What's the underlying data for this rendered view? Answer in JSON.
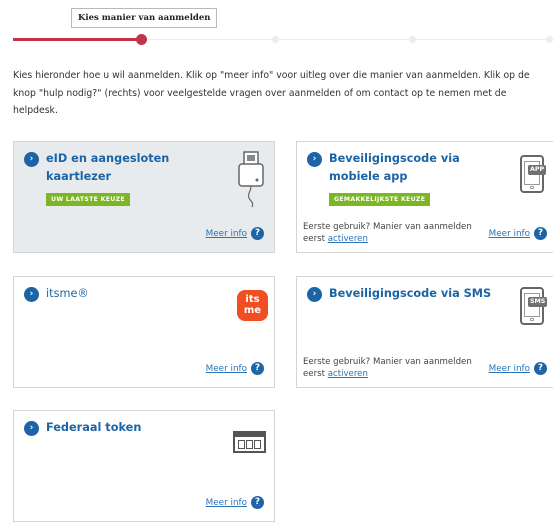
{
  "stepper": {
    "tooltip": "Kies manier van aanmelden",
    "accent_color": "#c2334d"
  },
  "intro": "Kies hieronder hoe u wil aanmelden. Klik op \"meer info\" voor uitleg over die manier van aanmelden. Klik op de knop \"hulp nodig?\" (rechts) voor veelgestelde vragen over aanmelden of om contact op te nemen met de helpdesk.",
  "common": {
    "meer_info": "Meer info",
    "help_glyph": "?",
    "chevron_glyph": "›",
    "first_use_text": "Eerste gebruik? Manier van aanmelden eerst",
    "activate_link": "activeren"
  },
  "methods": [
    {
      "title": "eID en aangesloten kaartlezer",
      "badge": "UW LAATSTE KEUZE",
      "selected": true
    },
    {
      "title": "Beveiligingscode via mobiele app",
      "badge": "GEMAKKELIJKSTE KEUZE",
      "icon_label": "APP"
    },
    {
      "title": "itsme®",
      "logo_text": "its me"
    },
    {
      "title": "Beveiligingscode via SMS",
      "icon_label": "SMS"
    },
    {
      "title": "Federaal token"
    }
  ],
  "colors": {
    "brand_blue": "#1d64a6",
    "badge_green": "#7cb624",
    "selected_bg": "#e8ebee",
    "itsme_orange": "#ef4f23"
  }
}
